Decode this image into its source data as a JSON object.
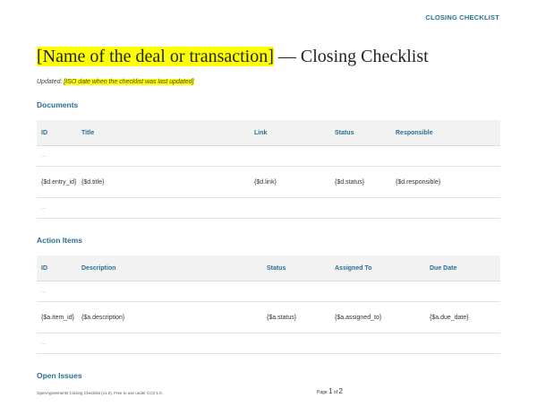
{
  "header": {
    "label": "CLOSING CHECKLIST"
  },
  "title": {
    "placeholder": "[Name of the deal or transaction]",
    "suffix": " — Closing Checklist"
  },
  "updated": {
    "label": "Updated: ",
    "value": "[ISO date when the checklist was last updated]"
  },
  "documents": {
    "heading": "Documents",
    "columns": [
      "ID",
      "Title",
      "Link",
      "Status",
      "Responsible"
    ],
    "ellipsis": "...",
    "row": [
      "{$d.entry_id}",
      "{$d.title}",
      "{$d.link}",
      "{$d.status}",
      "{$d.responsible}"
    ]
  },
  "actions": {
    "heading": "Action Items",
    "columns": [
      "ID",
      "Description",
      "Status",
      "Assigned To",
      "Due Date"
    ],
    "ellipsis": "...",
    "row": [
      "{$a.item_id}",
      "{$a.description}",
      "{$a.status}",
      "{$a.assigned_to}",
      "{$a.due_date}"
    ]
  },
  "issues": {
    "heading": "Open Issues"
  },
  "footer": {
    "text": "OpenAgreements Closing Checklist (v1.0). Free to use under CC0 1.0.",
    "page_label": "Page ",
    "page": "1",
    "of": " of ",
    "total": "2"
  }
}
